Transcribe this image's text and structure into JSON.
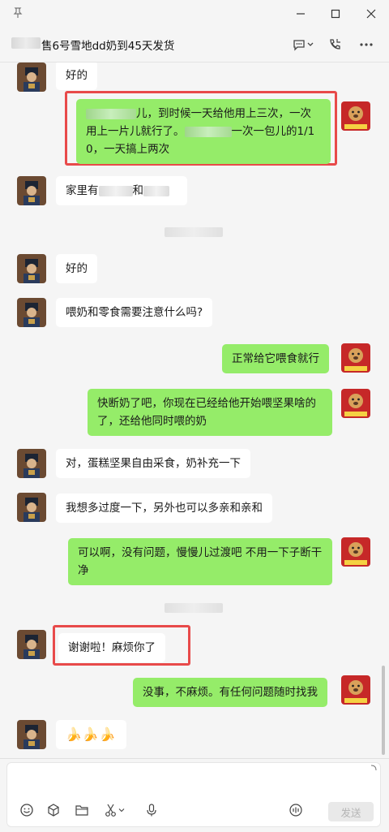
{
  "window": {
    "title": "售6号雪地dd奶到45天发货",
    "pin_icon": "pin-icon",
    "minimize_icon": "minimize-icon",
    "maximize_icon": "maximize-icon",
    "close_icon": "close-icon"
  },
  "header": {
    "chat_icon": "chat-bubble-icon",
    "chevron_icon": "chevron-down-icon",
    "call_icon": "phone-icon",
    "more_icon": "more-icon"
  },
  "messages": [
    {
      "side": "left",
      "text": "好的"
    },
    {
      "side": "right",
      "parts": [
        "儿，到时候一天给他用上三次，一次用上一片儿就行了。",
        "一次一包儿的1/10，一天搞上两次"
      ],
      "highlighted": true
    },
    {
      "side": "left",
      "parts": [
        "家里有",
        "和"
      ]
    },
    {
      "side": "left",
      "text": "好的"
    },
    {
      "side": "left",
      "text": "喂奶和零食需要注意什么吗?"
    },
    {
      "side": "right",
      "text": "正常给它喂食就行"
    },
    {
      "side": "right",
      "text": "快断奶了吧，你现在已经给他开始喂坚果啥的了，还给他同时喂的奶"
    },
    {
      "side": "left",
      "text": "对，蛋糕坚果自由采食，奶补充一下"
    },
    {
      "side": "left",
      "text": "我想多过度一下，另外也可以多亲和亲和"
    },
    {
      "side": "right",
      "text": "可以啊，没有问题，慢慢儿过渡吧 不用一下子断干净"
    },
    {
      "side": "left",
      "text": "谢谢啦！麻烦你了",
      "highlighted": true
    },
    {
      "side": "right",
      "text": "没事，不麻烦。有任何问题随时找我"
    },
    {
      "side": "left",
      "text": "🍌🍌🍌"
    }
  ],
  "input": {
    "send_label": "发送",
    "tools": [
      "emoji-icon",
      "cube-icon",
      "folder-icon",
      "scissors-icon",
      "microphone-icon",
      "voice-input-icon"
    ]
  },
  "colors": {
    "bubble_self": "#95ec69",
    "bubble_other": "#ffffff",
    "highlight_box": "#e84a4a",
    "background": "#f5f5f5"
  }
}
